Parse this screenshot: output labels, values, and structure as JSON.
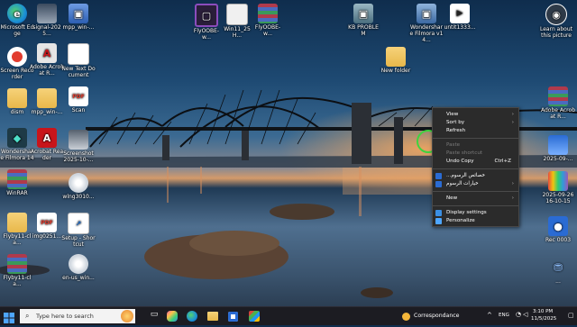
{
  "desktop": {
    "icons": [
      {
        "label": "Microsoft Edge",
        "icon": "edge-icon",
        "color": "#1b8fd6"
      },
      {
        "label": "signal-2025...",
        "icon": "image-file-icon",
        "color": "#6d7788"
      },
      {
        "label": "mpp_win-...",
        "icon": "installer-icon",
        "color": "#3c6fc2"
      },
      {
        "label": "Screen Recorder",
        "icon": "screen-recorder-icon",
        "color": "#e23c2f"
      },
      {
        "label": "Adobe Acrobat R...",
        "icon": "acrobat-icon",
        "color": "#cfcfcf"
      },
      {
        "label": "New Text Document",
        "icon": "text-file-icon",
        "color": "#ffffff"
      },
      {
        "label": "dism",
        "icon": "folder-icon",
        "color": "#e8b84a"
      },
      {
        "label": "mpp_win-...",
        "icon": "folder-icon",
        "color": "#e8b84a"
      },
      {
        "label": "Scan",
        "icon": "pdf-icon",
        "color": "#e23c2f"
      },
      {
        "label": "Wondershare Filmora 14",
        "icon": "filmora-icon",
        "color": "#1e3a46"
      },
      {
        "label": "Acrobat Reader",
        "icon": "acrobat-reader-icon",
        "color": "#c8151b"
      },
      {
        "label": "Screenshot 2025-10-...",
        "icon": "image-file-icon",
        "color": "#8d99a6"
      },
      {
        "label": "WinRAR",
        "icon": "winrar-icon",
        "color": "#a53a4a"
      },
      {
        "label": "wlng3010...",
        "icon": "disc-image-icon",
        "color": "#d9d9d9"
      },
      {
        "label": "Flyby11-cla...",
        "icon": "folder-icon",
        "color": "#e8b84a"
      },
      {
        "label": "img0251...",
        "icon": "pdf-icon",
        "color": "#e23c2f"
      },
      {
        "label": "Setup - Shortcut",
        "icon": "shortcut-file-icon",
        "color": "#ffffff"
      },
      {
        "label": "Flyby11-cla...",
        "icon": "winrar-icon",
        "color": "#a53a4a"
      },
      {
        "label": "en-us_win...",
        "icon": "disc-image-icon",
        "color": "#d9d9d9"
      },
      {
        "label": "FlyOOBE-w...",
        "icon": "flyoobe-icon",
        "color": "#8b4dbd"
      },
      {
        "label": "Win11_25H...",
        "icon": "disc-image-icon",
        "color": "#d9d9d9"
      },
      {
        "label": "FlyOOBE-w...",
        "icon": "winrar-icon",
        "color": "#a53a4a"
      },
      {
        "label": "KB PROBLEM",
        "icon": "installer-icon",
        "color": "#6c8c99"
      },
      {
        "label": "Wondershare Filmora v14...",
        "icon": "installer-icon",
        "color": "#5a79a0"
      },
      {
        "label": "untit1333...",
        "icon": "media-file-icon",
        "color": "#ffffff"
      },
      {
        "label": "Learn about this picture",
        "icon": "camera-icon",
        "color": "#2e3a48"
      },
      {
        "label": "New folder",
        "icon": "folder-icon",
        "color": "#e8b84a"
      },
      {
        "label": "Adobe Acrobat R...",
        "icon": "winrar-icon",
        "color": "#a53a4a"
      },
      {
        "label": "2025-09-...",
        "icon": "image-file-icon",
        "color": "#2a6bd3"
      },
      {
        "label": "2025-09-26 16-10-15",
        "icon": "video-file-icon",
        "color": "#7b3fb6"
      },
      {
        "label": "Rec 0003",
        "icon": "recording-icon",
        "color": "#2a6bd3"
      },
      {
        "label": "...",
        "icon": "network-icon",
        "color": "#6fa0d8"
      }
    ]
  },
  "context_menu": {
    "items": [
      {
        "label": "View",
        "type": "submenu",
        "disabled": false
      },
      {
        "label": "Sort by",
        "type": "submenu",
        "disabled": false
      },
      {
        "label": "Refresh",
        "type": "item",
        "disabled": false
      },
      {
        "type": "separator"
      },
      {
        "label": "Paste",
        "type": "item",
        "disabled": true
      },
      {
        "label": "Paste shortcut",
        "type": "item",
        "disabled": true
      },
      {
        "label": "Undo Copy",
        "type": "item",
        "disabled": false,
        "shortcut": "Ctrl+Z"
      },
      {
        "type": "separator"
      },
      {
        "label": "...خصائص الرسوم",
        "type": "item",
        "disabled": false
      },
      {
        "label": "خيارات الرسوم",
        "type": "submenu",
        "disabled": false
      },
      {
        "type": "separator"
      },
      {
        "label": "New",
        "type": "submenu",
        "disabled": false
      },
      {
        "type": "separator"
      },
      {
        "label": "Display settings",
        "type": "item",
        "disabled": false,
        "icon": "display-settings-icon"
      },
      {
        "label": "Personalize",
        "type": "item",
        "disabled": false,
        "icon": "personalize-icon"
      }
    ]
  },
  "taskbar": {
    "search_placeholder": "Type here to search",
    "weather_label": "Correspondance",
    "language": "ENG",
    "time": "3:10 PM",
    "date": "11/5/2025"
  },
  "colors": {
    "accent": "#0078d4",
    "menu_bg": "#2b2b2b",
    "taskbar_bg": "#1c1c22"
  }
}
